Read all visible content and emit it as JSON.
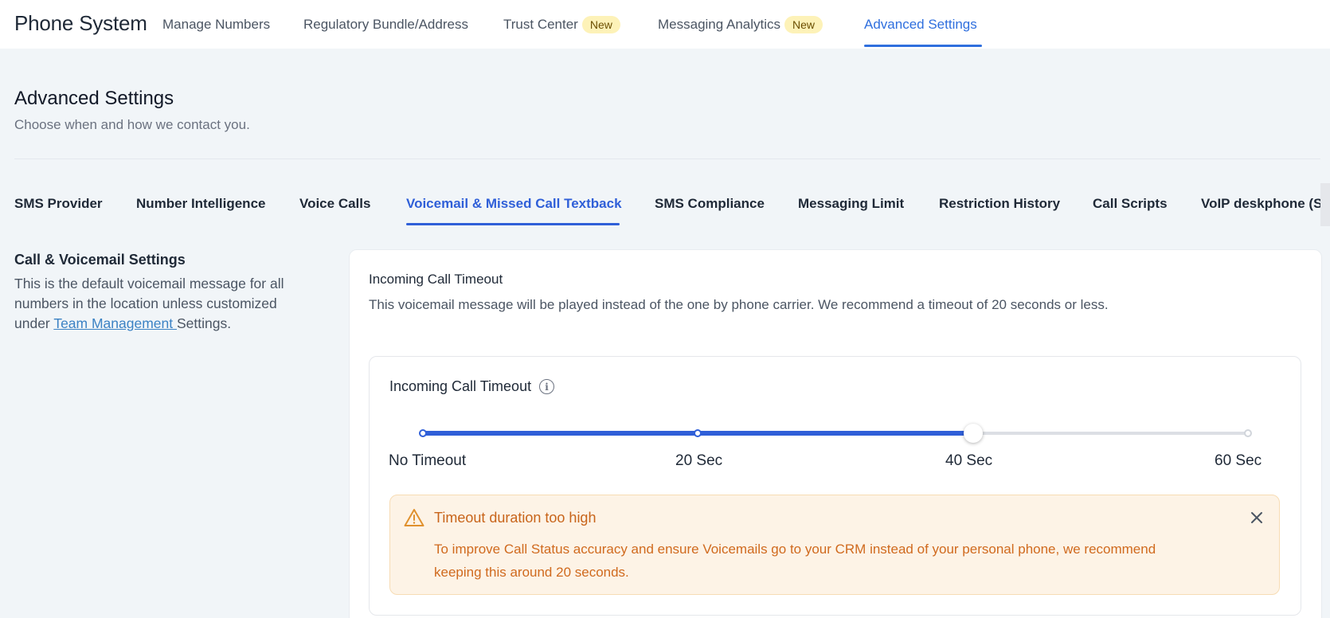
{
  "app": {
    "title": "Phone System"
  },
  "topnav": {
    "items": [
      {
        "label": "Manage Numbers"
      },
      {
        "label": "Regulatory Bundle/Address"
      },
      {
        "label": "Trust Center",
        "badge": "New"
      },
      {
        "label": "Messaging Analytics",
        "badge": "New"
      },
      {
        "label": "Advanced Settings",
        "active": true
      }
    ]
  },
  "header": {
    "title": "Advanced Settings",
    "subtitle": "Choose when and how we contact you."
  },
  "subtabs": {
    "items": [
      {
        "label": "SMS Provider"
      },
      {
        "label": "Number Intelligence"
      },
      {
        "label": "Voice Calls"
      },
      {
        "label": "Voicemail & Missed Call Textback",
        "active": true
      },
      {
        "label": "SMS Compliance"
      },
      {
        "label": "Messaging Limit"
      },
      {
        "label": "Restriction History"
      },
      {
        "label": "Call Scripts"
      },
      {
        "label": "VoIP deskphone (S"
      }
    ]
  },
  "section": {
    "title": "Call & Voicemail Settings",
    "desc_before": "This is the default voicemail message for all numbers in the location unless customized under ",
    "link": "Team Management ",
    "desc_after": "Settings."
  },
  "card": {
    "heading": "Incoming Call Timeout",
    "description": "This voicemail message will be played instead of the one by phone carrier. We recommend a timeout of 20 seconds or less."
  },
  "slider": {
    "title": "Incoming Call Timeout",
    "info_icon": "info-circle-icon",
    "labels": [
      "No Timeout",
      "20 Sec",
      "40 Sec",
      "60 Sec"
    ],
    "stops": [
      0,
      20,
      40,
      60
    ],
    "value": 40,
    "min": 0,
    "max": 60,
    "accent": "#2f5fd8"
  },
  "alert": {
    "icon": "warning-triangle-icon",
    "title": "Timeout duration too high",
    "body": "To improve Call Status accuracy and ensure Voicemails go to your CRM instead of your personal phone, we recommend keeping this around 20 seconds.",
    "close_icon": "close-icon",
    "color": "#c8641a"
  }
}
